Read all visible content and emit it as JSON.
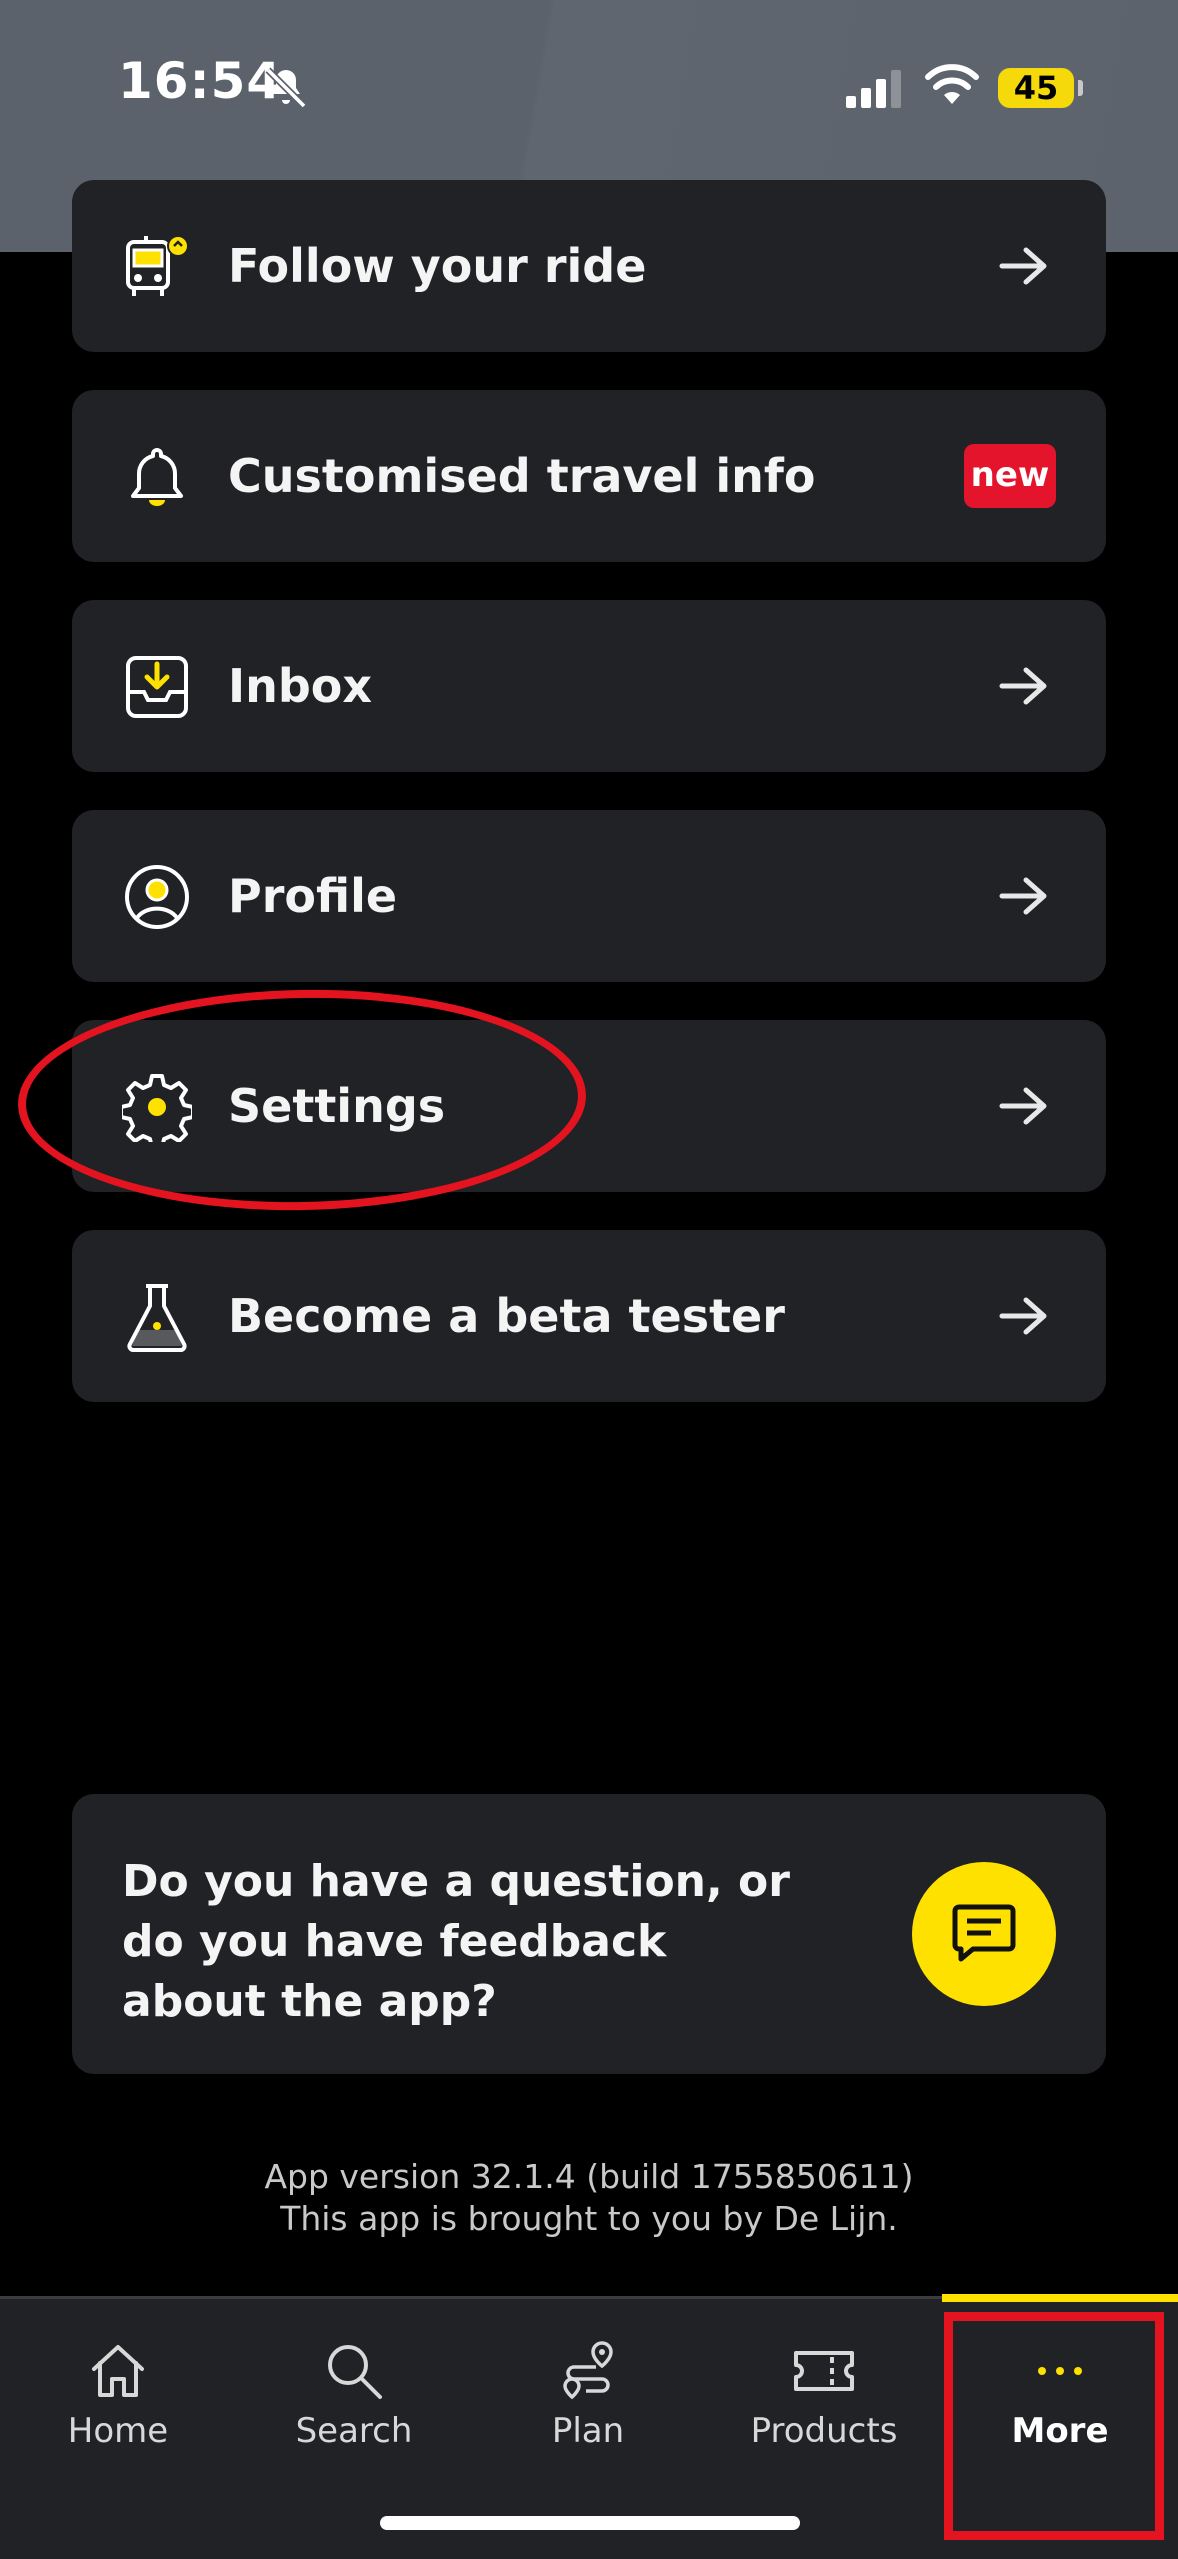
{
  "status_bar": {
    "time": "16:54",
    "battery": "45"
  },
  "menu": [
    {
      "label": "Follow your ride",
      "icon": "bus-tracking-icon",
      "trailing": "arrow"
    },
    {
      "label": "Customised travel info",
      "icon": "bell-icon",
      "trailing": "badge",
      "badge": "new"
    },
    {
      "label": "Inbox",
      "icon": "inbox-icon",
      "trailing": "arrow"
    },
    {
      "label": "Profile",
      "icon": "profile-icon",
      "trailing": "arrow"
    },
    {
      "label": "Settings",
      "icon": "gear-icon",
      "trailing": "arrow"
    },
    {
      "label": "Become a beta tester",
      "icon": "flask-icon",
      "trailing": "arrow"
    }
  ],
  "feedback": {
    "text": "Do you have a question, or do you have feedback about the app?",
    "button_icon": "chat-icon"
  },
  "footer": {
    "version": "App version 32.1.4 (build 1755850611)",
    "credit": "This app is brought to you by De Lijn."
  },
  "tabs": [
    {
      "label": "Home",
      "icon": "home-icon"
    },
    {
      "label": "Search",
      "icon": "search-icon"
    },
    {
      "label": "Plan",
      "icon": "route-icon"
    },
    {
      "label": "Products",
      "icon": "ticket-icon"
    },
    {
      "label": "More",
      "icon": "more-icon",
      "active": true
    }
  ],
  "colors": {
    "accent": "#ffe100",
    "badge": "#e3142c",
    "card": "#202226",
    "annotation": "#e3141f"
  }
}
